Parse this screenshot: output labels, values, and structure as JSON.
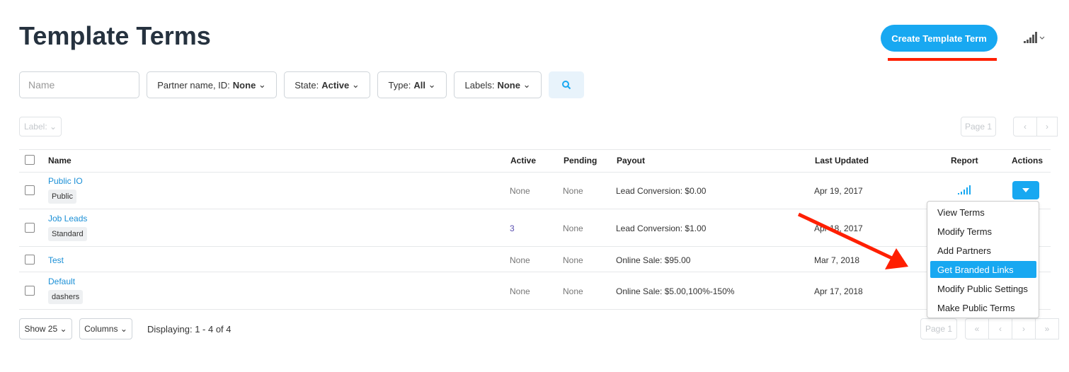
{
  "page_title": "Template Terms",
  "create_button": "Create Template Term",
  "colors": {
    "accent": "#18a8f1",
    "annotation": "#ff1f00"
  },
  "filters": {
    "name_placeholder": "Name",
    "partner": {
      "label": "Partner name, ID:",
      "value": "None"
    },
    "state": {
      "label": "State:",
      "value": "Active"
    },
    "type": {
      "label": "Type:",
      "value": "All"
    },
    "labels": {
      "label": "Labels:",
      "value": "None"
    }
  },
  "label_select": "Label:",
  "page_indicator": "Page 1",
  "table": {
    "headers": {
      "name": "Name",
      "active": "Active",
      "pending": "Pending",
      "payout": "Payout",
      "last_updated": "Last Updated",
      "report": "Report",
      "actions": "Actions"
    },
    "rows": [
      {
        "name": "Public IO",
        "tag": "Public",
        "active": "None",
        "pending": "None",
        "payout": "Lead Conversion: $0.00",
        "last_updated": "Apr 19, 2017"
      },
      {
        "name": "Job Leads",
        "tag": "Standard",
        "active": "3",
        "pending": "None",
        "payout": "Lead Conversion: $1.00",
        "last_updated": "Apr 18, 2017"
      },
      {
        "name": "Test",
        "tag": "",
        "active": "None",
        "pending": "None",
        "payout": "Online Sale: $95.00",
        "last_updated": "Mar 7, 2018"
      },
      {
        "name": "Default",
        "tag": "dashers",
        "active": "None",
        "pending": "None",
        "payout": "Online Sale: $5.00,100%-150%",
        "last_updated": "Apr 17, 2018"
      }
    ]
  },
  "actions_menu": [
    "View Terms",
    "Modify Terms",
    "Add Partners",
    "Get Branded Links",
    "Modify Public Settings",
    "Make Public Terms"
  ],
  "actions_menu_highlighted": "Get Branded Links",
  "footer": {
    "show": "Show 25",
    "columns": "Columns",
    "displaying": "Displaying: 1 - 4 of 4",
    "page": "Page 1"
  }
}
